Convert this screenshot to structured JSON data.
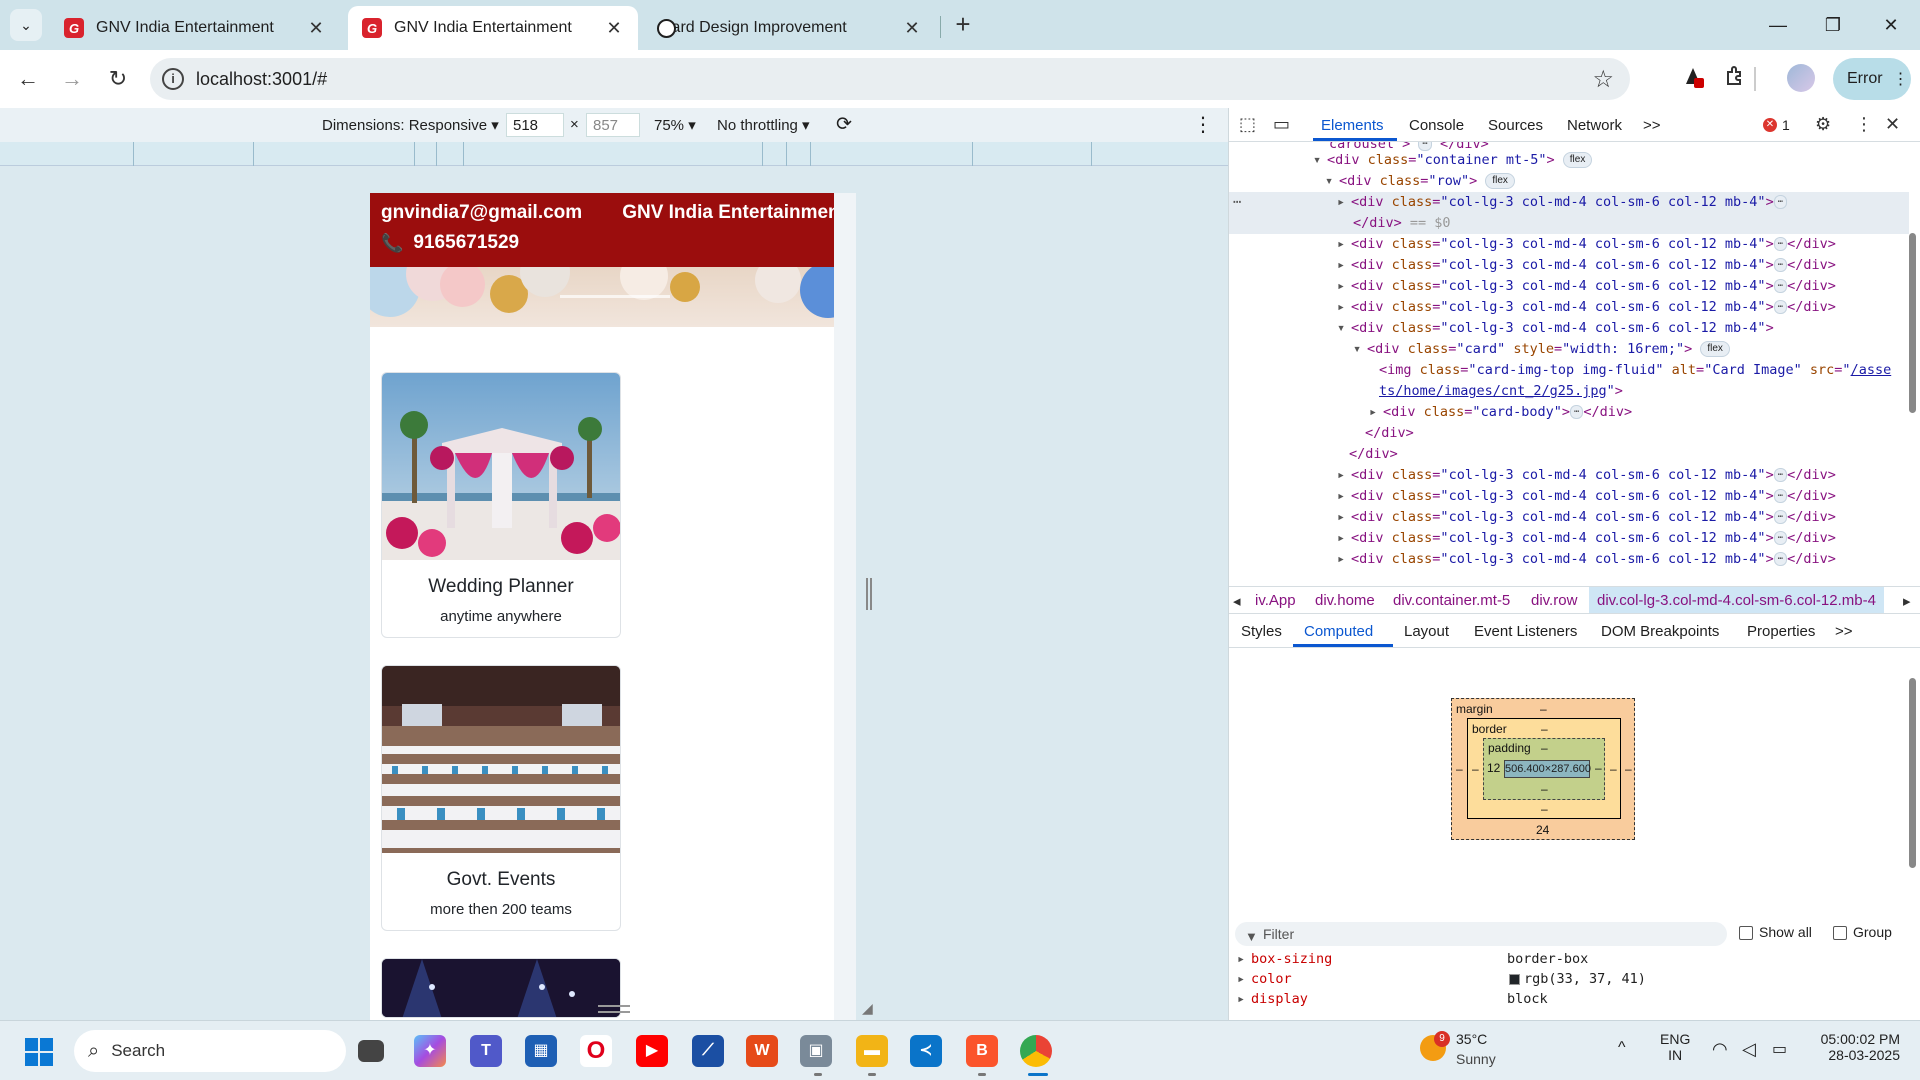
{
  "browser": {
    "tabs": [
      {
        "title": "GNV India Entertainment",
        "active": false,
        "favicon": "gnv-logo-icon"
      },
      {
        "title": "GNV India Entertainment",
        "active": true,
        "favicon": "gnv-logo-icon"
      },
      {
        "title": "Card Design Improvement",
        "active": false,
        "favicon": "openai-logo-icon"
      }
    ],
    "url": "localhost:3001/#",
    "profile_button": "Error"
  },
  "device_toolbar": {
    "dimensions_label": "Dimensions: Responsive",
    "width": "518",
    "height": "857",
    "times": "×",
    "zoom": "75%",
    "throttling": "No throttling"
  },
  "site": {
    "email": "gnvindia7@gmail.com",
    "brand": "GNV India Entertainment",
    "phone": "9165671529",
    "cards": [
      {
        "title": "Wedding Planner",
        "text": "anytime anywhere"
      },
      {
        "title": "Govt. Events",
        "text": "more then 200 teams"
      }
    ]
  },
  "devtools": {
    "tabs": [
      "Elements",
      "Console",
      "Sources",
      "Network"
    ],
    "active_tab": "Elements",
    "more": ">>",
    "error_count": "1",
    "breadcrumbs": [
      "iv.App",
      "div.home",
      "div.container.mt-5",
      "div.row",
      "div.col-lg-3.col-md-4.col-sm-6.col-12.mb-4"
    ],
    "subtabs": [
      "Styles",
      "Computed",
      "Layout",
      "Event Listeners",
      "DOM Breakpoints",
      "Properties"
    ],
    "active_subtab": "Computed",
    "col_class": "col-lg-3 col-md-4 col-sm-6 col-12 mb-4",
    "code": {
      "carousel_frag": "carousel",
      "container_class": "container mt-5",
      "row_class": "row",
      "card_class": "card",
      "card_style": "width: 16rem;",
      "img_class": "card-img-top img-fluid",
      "img_alt": "Card Image",
      "img_src_1": "/asse",
      "img_src_2": "ts/home/images/cnt_2/g25.jpg",
      "body_class": "card-body",
      "eq": "== $0",
      "flex": "flex"
    },
    "box_model": {
      "margin": "margin",
      "border": "border",
      "padding": "padding",
      "content": "506.400×287.600",
      "padding_left": "12",
      "margin_bottom": "24",
      "dash": "–"
    },
    "filter_placeholder": "Filter",
    "show_all": "Show all",
    "group": "Group",
    "properties": [
      {
        "name": "box-sizing",
        "value": "border-box"
      },
      {
        "name": "color",
        "value": "rgb(33, 37, 41)"
      },
      {
        "name": "display",
        "value": "block"
      }
    ]
  },
  "taskbar": {
    "search": "Search",
    "weather_temp": "35°C",
    "weather_desc": "Sunny",
    "weather_badge": "9",
    "lang_1": "ENG",
    "lang_2": "IN",
    "time": "05:00:02 PM",
    "date": "28-03-2025"
  },
  "colors": {
    "header_red": "#9b0d0d",
    "devtools_accent": "#0b57d0"
  }
}
